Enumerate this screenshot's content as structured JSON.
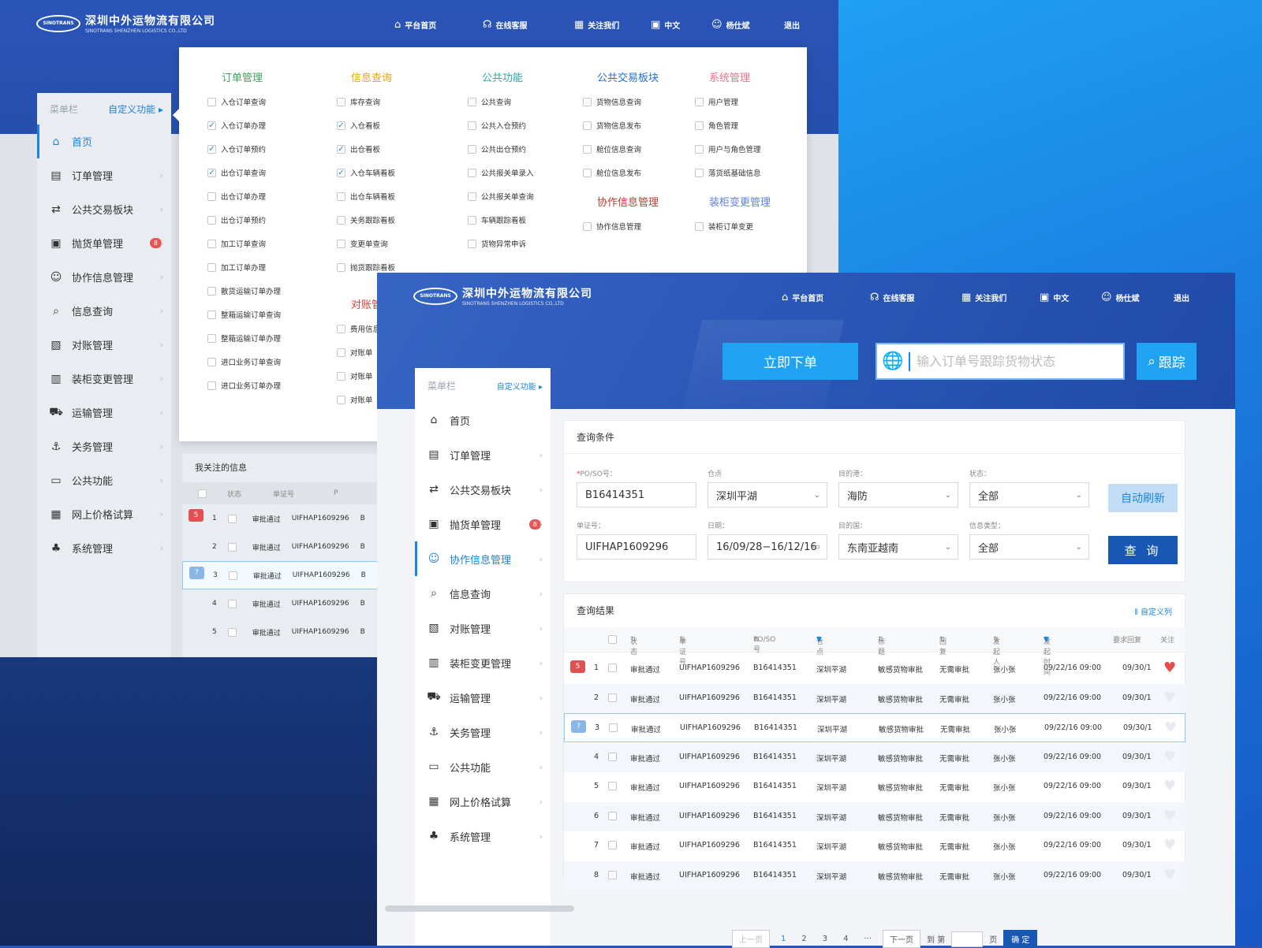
{
  "brand": {
    "name": "深圳中外运物流有限公司",
    "sub": "SINOTRANS SHENZHEN LOGISTICS CO.,LTD",
    "mark": "SINOTRANS"
  },
  "topnav": {
    "home": "平台首页",
    "service": "在线客服",
    "follow": "关注我们",
    "lang": "中文",
    "user": "杨仕斌",
    "logout": "退出"
  },
  "sidebar": {
    "head_label": "菜单栏",
    "custom_label": "自定义功能",
    "items": [
      {
        "label": "首页",
        "icon": "home-icon"
      },
      {
        "label": "订单管理",
        "icon": "document-icon"
      },
      {
        "label": "公共交易板块",
        "icon": "exchange-icon"
      },
      {
        "label": "抛货单管理",
        "icon": "box-icon",
        "badge": "8"
      },
      {
        "label": "协作信息管理",
        "icon": "users-icon"
      },
      {
        "label": "信息查询",
        "icon": "search-icon"
      },
      {
        "label": "对账管理",
        "icon": "ledger-icon"
      },
      {
        "label": "装柜变更管理",
        "icon": "container-icon"
      },
      {
        "label": "运输管理",
        "icon": "truck-icon"
      },
      {
        "label": "关务管理",
        "icon": "anchor-icon"
      },
      {
        "label": "公共功能",
        "icon": "monitor-icon"
      },
      {
        "label": "网上价格试算",
        "icon": "calculator-icon"
      },
      {
        "label": "系统管理",
        "icon": "org-icon"
      }
    ]
  },
  "dropdown": {
    "col1": {
      "title": "订单管理",
      "title_color": "#3aa55a",
      "options": [
        {
          "label": "入仓订单查询",
          "checked": false
        },
        {
          "label": "入仓订单办理",
          "checked": true
        },
        {
          "label": "入仓订单预约",
          "checked": true
        },
        {
          "label": "出仓订单查询",
          "checked": true
        },
        {
          "label": "出仓订单办理",
          "checked": false
        },
        {
          "label": "出仓订单预约",
          "checked": false
        },
        {
          "label": "加工订单查询",
          "checked": false
        },
        {
          "label": "加工订单办理",
          "checked": false
        },
        {
          "label": "散货运输订单办理",
          "checked": false
        },
        {
          "label": "整箱运输订单查询",
          "checked": false
        },
        {
          "label": "整箱运输订单办理",
          "checked": false
        },
        {
          "label": "进口业务订单查询",
          "checked": false
        },
        {
          "label": "进口业务订单办理",
          "checked": false
        }
      ]
    },
    "col2": {
      "title": "信息查询",
      "title_color": "#e8a317",
      "options": [
        {
          "label": "库存查询",
          "checked": false
        },
        {
          "label": "入仓看板",
          "checked": true
        },
        {
          "label": "出仓看板",
          "checked": true
        },
        {
          "label": "入仓车辆看板",
          "checked": true
        },
        {
          "label": "出仓车辆看板",
          "checked": false
        },
        {
          "label": "关务跟踪看板",
          "checked": false
        },
        {
          "label": "变更单查询",
          "checked": false
        },
        {
          "label": "抛货跟踪看板",
          "checked": false
        }
      ],
      "title2": "对账管",
      "title2_color": "#e03a3a",
      "options2": [
        {
          "label": "费用信息"
        },
        {
          "label": "对账单"
        },
        {
          "label": "对账单"
        },
        {
          "label": "对账单"
        }
      ]
    },
    "col3": {
      "title": "公共功能",
      "title_color": "#2aa9a0",
      "options": [
        {
          "label": "公共查询"
        },
        {
          "label": "公共入仓预约"
        },
        {
          "label": "公共出仓预约"
        },
        {
          "label": "公共报关单录入"
        },
        {
          "label": "公共报关单查询"
        },
        {
          "label": "车辆跟踪看板"
        },
        {
          "label": "货物异常申诉"
        }
      ]
    },
    "col4": {
      "title": "公共交易板块",
      "title_color": "#1f6fc8",
      "options": [
        {
          "label": "货物信息查询"
        },
        {
          "label": "货物信息发布"
        },
        {
          "label": "舱位信息查询"
        },
        {
          "label": "舱位信息发布"
        }
      ],
      "title2": "协作信息管理",
      "title2_color": "#c0392b",
      "options2": [
        {
          "label": "协作信息管理"
        }
      ]
    },
    "col5": {
      "title": "系统管理",
      "title_color": "#e8708a",
      "options": [
        {
          "label": "用户管理"
        },
        {
          "label": "角色管理"
        },
        {
          "label": "用户与角色管理"
        },
        {
          "label": "落货纸基础信息"
        }
      ],
      "title2": "装柜变更管理",
      "title2_color": "#5b7fe0",
      "options2": [
        {
          "label": "装柜订单变更"
        }
      ]
    }
  },
  "back_list": {
    "title": "我关注的信息",
    "headers": [
      "状态",
      "单证号",
      "P"
    ],
    "rows": [
      {
        "n": "1",
        "status": "审批通过",
        "doc": "UIFHAP1609296",
        "p": "B",
        "flag": "5"
      },
      {
        "n": "2",
        "status": "审批通过",
        "doc": "UIFHAP1609296",
        "p": "B"
      },
      {
        "n": "3",
        "status": "审批通过",
        "doc": "UIFHAP1609296",
        "p": "B",
        "flag": "?"
      },
      {
        "n": "4",
        "status": "审批通过",
        "doc": "UIFHAP1609296",
        "p": "B"
      },
      {
        "n": "5",
        "status": "审批通过",
        "doc": "UIFHAP1609296",
        "p": "B"
      }
    ]
  },
  "hero": {
    "order_btn": "立即下单",
    "search_placeholder": "输入订单号跟踪货物状态",
    "track_btn": "跟踪"
  },
  "query": {
    "title": "查询条件",
    "po_label": "PO/SO号：",
    "po_value": "B16414351",
    "wh_label": "仓点",
    "wh_value": "深圳平湖",
    "port_label": "目的港：",
    "port_value": "海防",
    "status_label": "状态：",
    "status_value": "全部",
    "doc_label": "单证号：",
    "doc_value": "UIFHAP1609296",
    "date_label": "日期：",
    "date_value": "16/09/28−16/12/16",
    "country_label": "目的国：",
    "country_value": "东南亚越南",
    "type_label": "信息类型：",
    "type_value": "全部",
    "auto_btn": "自动刷新",
    "query_btn": "查 询"
  },
  "results": {
    "title": "查询结果",
    "custom_cols": "自定义列",
    "headers": [
      "状态",
      "单证号",
      "PO/SO号",
      "仓点",
      "标题",
      "回复",
      "发起人",
      "发起时间",
      "要求回复",
      "关注"
    ],
    "rows": [
      {
        "n": "1",
        "status": "审批通过",
        "doc": "UIFHAP1609296",
        "po": "B16414351",
        "wh": "深圳平湖",
        "title": "敏感货物审批",
        "reply": "无需审批",
        "by": "张小张",
        "time": "09/22/16  09:00",
        "req": "09/30/1",
        "fav": true,
        "flag": "5"
      },
      {
        "n": "2",
        "status": "审批通过",
        "doc": "UIFHAP1609296",
        "po": "B16414351",
        "wh": "深圳平湖",
        "title": "敏感货物审批",
        "reply": "无需审批",
        "by": "张小张",
        "time": "09/22/16  09:00",
        "req": "09/30/1",
        "fav": false
      },
      {
        "n": "3",
        "status": "审批通过",
        "doc": "UIFHAP1609296",
        "po": "B16414351",
        "wh": "深圳平湖",
        "title": "敏感货物审批",
        "reply": "无需审批",
        "by": "张小张",
        "time": "09/22/16  09:00",
        "req": "09/30/1",
        "fav": false,
        "flag": "?"
      },
      {
        "n": "4",
        "status": "审批通过",
        "doc": "UIFHAP1609296",
        "po": "B16414351",
        "wh": "深圳平湖",
        "title": "敏感货物审批",
        "reply": "无需审批",
        "by": "张小张",
        "time": "09/22/16  09:00",
        "req": "09/30/1",
        "fav": false
      },
      {
        "n": "5",
        "status": "审批通过",
        "doc": "UIFHAP1609296",
        "po": "B16414351",
        "wh": "深圳平湖",
        "title": "敏感货物审批",
        "reply": "无需审批",
        "by": "张小张",
        "time": "09/22/16  09:00",
        "req": "09/30/1",
        "fav": false
      },
      {
        "n": "6",
        "status": "审批通过",
        "doc": "UIFHAP1609296",
        "po": "B16414351",
        "wh": "深圳平湖",
        "title": "敏感货物审批",
        "reply": "无需审批",
        "by": "张小张",
        "time": "09/22/16  09:00",
        "req": "09/30/1",
        "fav": false
      },
      {
        "n": "7",
        "status": "审批通过",
        "doc": "UIFHAP1609296",
        "po": "B16414351",
        "wh": "深圳平湖",
        "title": "敏感货物审批",
        "reply": "无需审批",
        "by": "张小张",
        "time": "09/22/16  09:00",
        "req": "09/30/1",
        "fav": false
      },
      {
        "n": "8",
        "status": "审批通过",
        "doc": "UIFHAP1609296",
        "po": "B16414351",
        "wh": "深圳平湖",
        "title": "敏感货物审批",
        "reply": "无需审批",
        "by": "张小张",
        "time": "09/22/16  09:00",
        "req": "09/30/1",
        "fav": false
      }
    ]
  },
  "pager": {
    "prev": "上一页",
    "pages": [
      "1",
      "2",
      "3",
      "4"
    ],
    "ellipsis": "···",
    "next": "下一页",
    "goto": "到 第",
    "page_unit": "页",
    "ok": "确 定"
  }
}
